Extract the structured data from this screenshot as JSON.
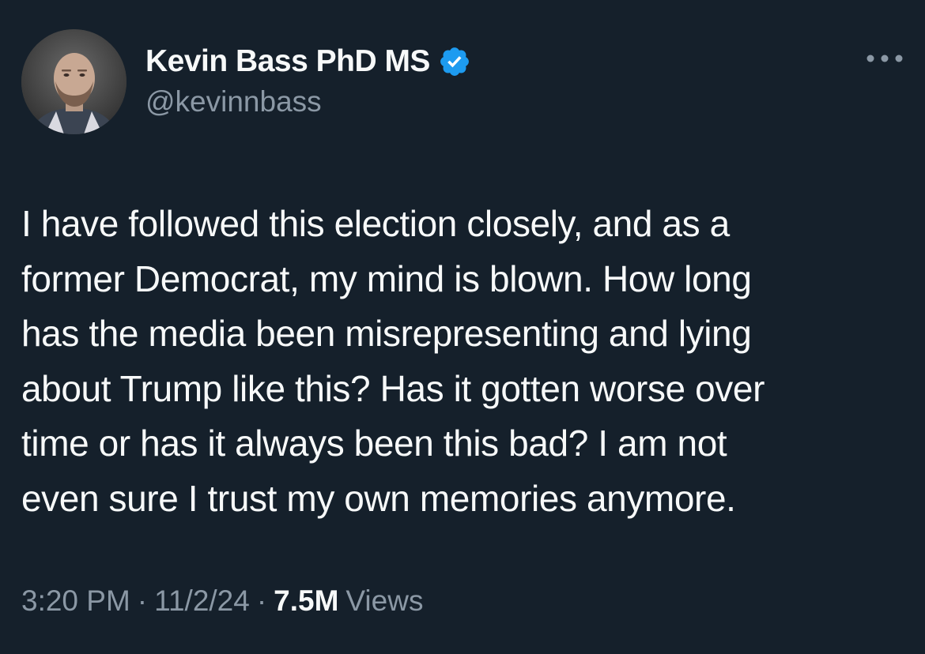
{
  "author": {
    "display_name": "Kevin Bass PhD MS",
    "handle": "@kevinnbass",
    "verified": true,
    "avatar": "profile-photo"
  },
  "tweet": {
    "text_lines": [
      "I have followed this election closely, and as a",
      "former Democrat, my mind is blown. How long",
      "has the media been misrepresenting and lying",
      "about Trump like this? Has it gotten worse over",
      "time or has it always been this bad? I am not",
      "even sure I trust my own memories anymore."
    ],
    "time": "3:20 PM",
    "separator": "·",
    "date": "11/2/24",
    "views_count": "7.5M",
    "views_label": "Views"
  },
  "icons": {
    "verified": "verified-badge-icon",
    "more": "more-options-icon"
  },
  "colors": {
    "background": "#15202b",
    "primary_text": "#f7f9f9",
    "secondary_text": "#8b98a5",
    "verified_blue": "#1d9bf0"
  }
}
